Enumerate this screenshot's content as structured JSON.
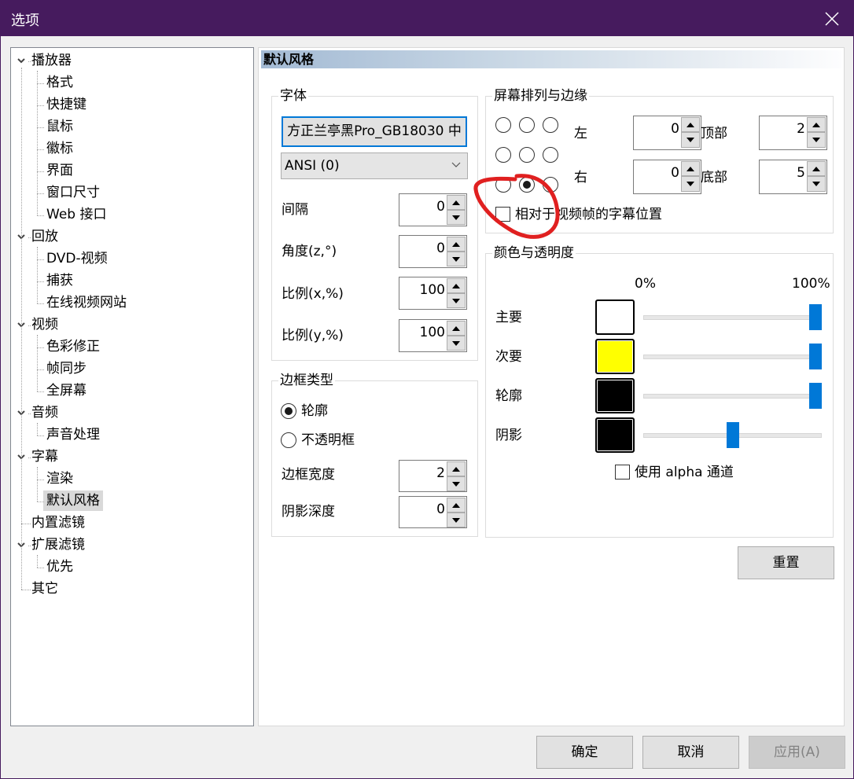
{
  "window": {
    "title": "选项",
    "close_icon": "close-icon",
    "title_bar_color": "#461b5e"
  },
  "tree": {
    "items": [
      {
        "label": "播放器",
        "level": 0,
        "expanded": true
      },
      {
        "label": "格式",
        "level": 1
      },
      {
        "label": "快捷键",
        "level": 1
      },
      {
        "label": "鼠标",
        "level": 1
      },
      {
        "label": "徽标",
        "level": 1
      },
      {
        "label": "界面",
        "level": 1
      },
      {
        "label": "窗口尺寸",
        "level": 1
      },
      {
        "label": "Web 接口",
        "level": 1
      },
      {
        "label": "回放",
        "level": 0,
        "expanded": true
      },
      {
        "label": "DVD-视频",
        "level": 1
      },
      {
        "label": "捕获",
        "level": 1
      },
      {
        "label": "在线视频网站",
        "level": 1
      },
      {
        "label": "视频",
        "level": 0,
        "expanded": true
      },
      {
        "label": "色彩修正",
        "level": 1
      },
      {
        "label": "帧同步",
        "level": 1
      },
      {
        "label": "全屏幕",
        "level": 1
      },
      {
        "label": "音频",
        "level": 0,
        "expanded": true
      },
      {
        "label": "声音处理",
        "level": 1
      },
      {
        "label": "字幕",
        "level": 0,
        "expanded": true
      },
      {
        "label": "渲染",
        "level": 1
      },
      {
        "label": "默认风格",
        "level": 1,
        "selected": true
      },
      {
        "label": "内置滤镜",
        "level": 0
      },
      {
        "label": "扩展滤镜",
        "level": 0,
        "expanded": true
      },
      {
        "label": "优先",
        "level": 1
      },
      {
        "label": "其它",
        "level": 0
      }
    ]
  },
  "panel": {
    "header": "默认风格",
    "font_group": {
      "label": "字体",
      "font_button": "方正兰亭黑Pro_GB18030 中",
      "charset_select": "ANSI (0)",
      "fields": [
        {
          "label": "间隔",
          "value": "0"
        },
        {
          "label": "角度(z,°)",
          "value": "0"
        },
        {
          "label": "比例(x,%)",
          "value": "100"
        },
        {
          "label": "比例(y,%)",
          "value": "100"
        }
      ]
    },
    "border_group": {
      "label": "边框类型",
      "radio_outline": "轮廓",
      "radio_opaque": "不透明框",
      "selected": "轮廓",
      "fields": [
        {
          "label": "边框宽度",
          "value": "2"
        },
        {
          "label": "阴影深度",
          "value": "0"
        }
      ]
    },
    "position_group": {
      "label": "屏幕排列与边缘",
      "alignment_selected": "bottom-center",
      "left_label": "左",
      "left_value": "0",
      "right_label": "右",
      "right_value": "0",
      "top_label": "顶部",
      "top_value": "2",
      "bottom_label": "底部",
      "bottom_value": "5",
      "relative_checkbox": "相对于视频帧的字幕位置",
      "relative_checked": false
    },
    "color_group": {
      "label": "颜色与透明度",
      "scale_min": "0%",
      "scale_max": "100%",
      "rows": [
        {
          "label": "主要",
          "color": "#ffffff",
          "opacity_percent": 100
        },
        {
          "label": "次要",
          "color": "#ffff00",
          "opacity_percent": 100
        },
        {
          "label": "轮廓",
          "color": "#000000",
          "opacity_percent": 100
        },
        {
          "label": "阴影",
          "color": "#000000",
          "opacity_percent": 50
        }
      ],
      "alpha_checkbox": "使用 alpha 通道",
      "alpha_checked": false,
      "slider_color": "#0078d7"
    },
    "reset_button": "重置"
  },
  "footer": {
    "ok": "确定",
    "cancel": "取消",
    "apply": "应用(A)"
  },
  "annotation": {
    "color": "#e02020"
  }
}
